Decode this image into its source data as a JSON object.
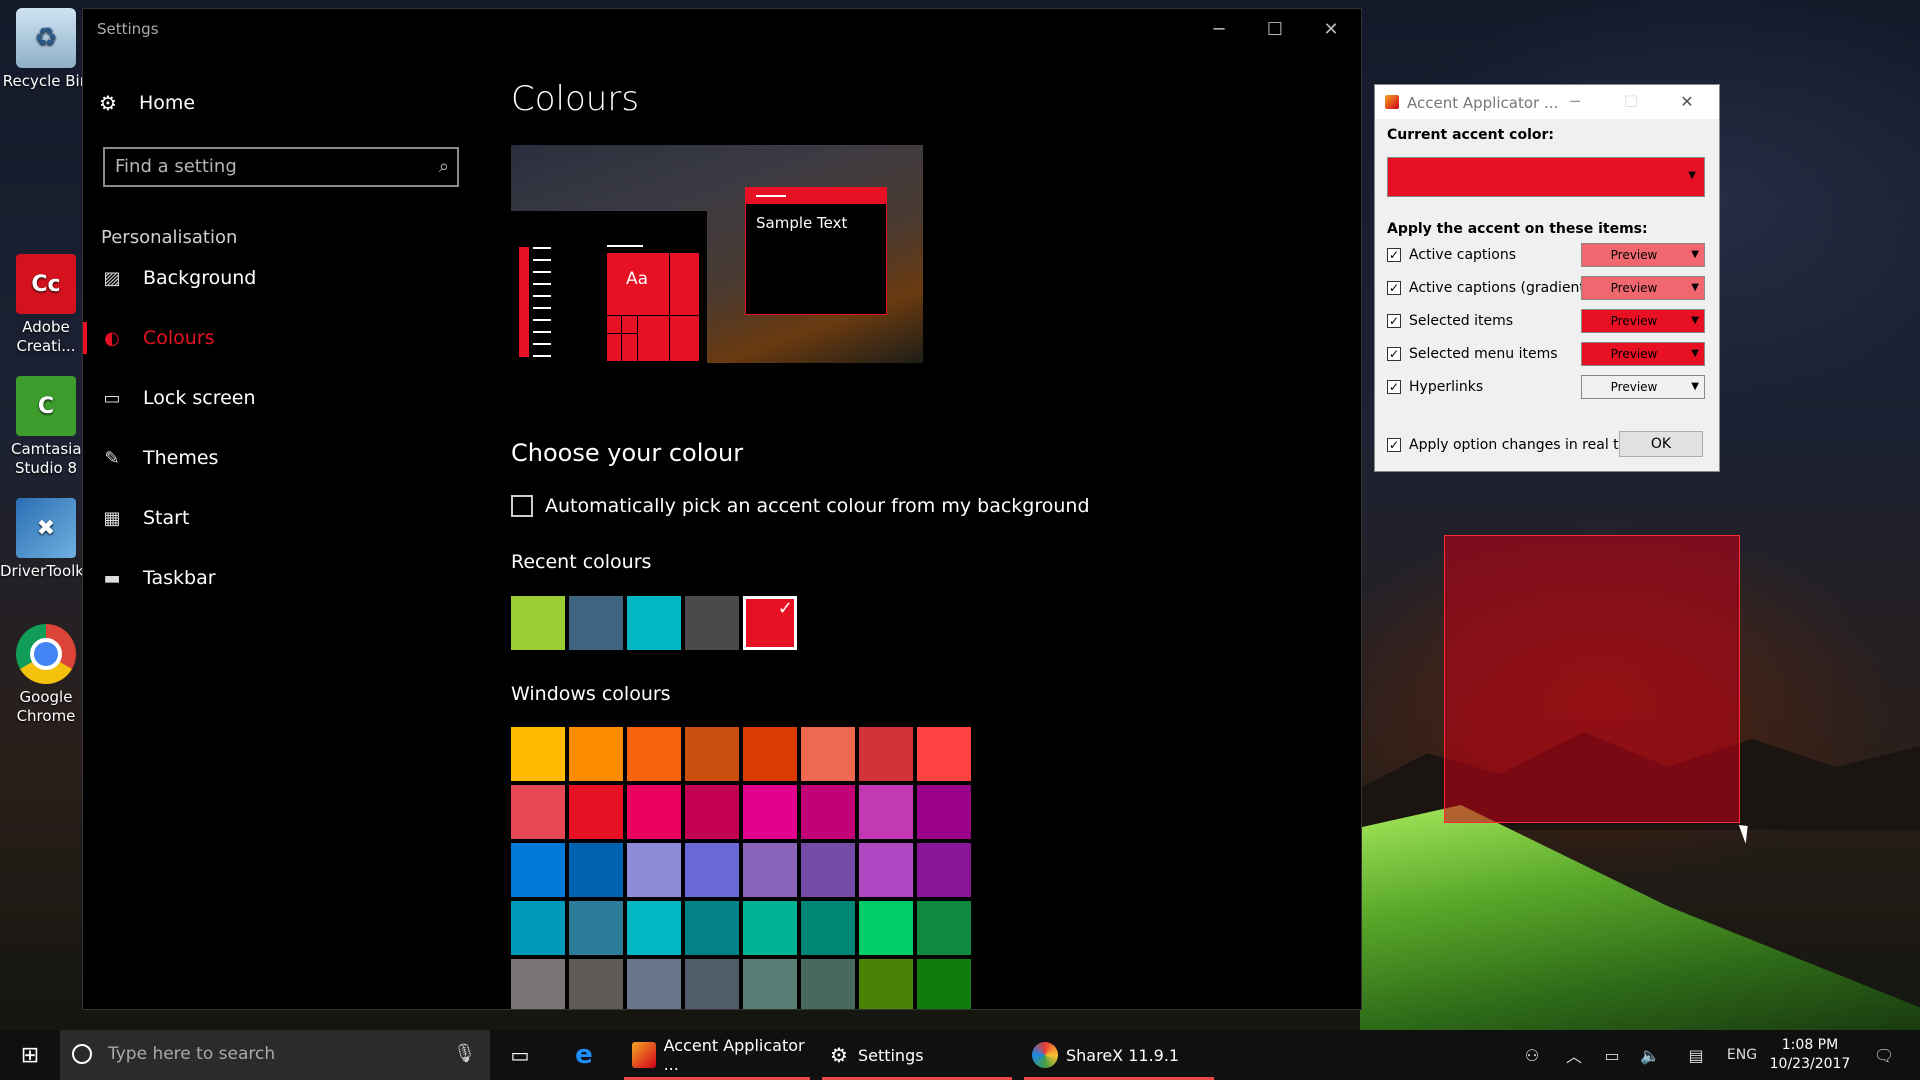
{
  "desktop": {
    "icons": [
      {
        "label": "Recycle Bin"
      },
      {
        "label": "Adobe Creati..."
      },
      {
        "label": "Camtasia Studio 8"
      },
      {
        "label": "DriverToolkit"
      },
      {
        "label": "Google Chrome"
      }
    ]
  },
  "settings": {
    "window_title": "Settings",
    "nav": {
      "home": "Home",
      "search_placeholder": "Find a setting",
      "section": "Personalisation",
      "items": [
        {
          "label": "Background",
          "icon": "image-icon"
        },
        {
          "label": "Colours",
          "icon": "palette-icon",
          "active": true
        },
        {
          "label": "Lock screen",
          "icon": "lock-screen-icon"
        },
        {
          "label": "Themes",
          "icon": "themes-icon"
        },
        {
          "label": "Start",
          "icon": "start-icon"
        },
        {
          "label": "Taskbar",
          "icon": "taskbar-icon"
        }
      ]
    },
    "content": {
      "title": "Colours",
      "preview_aa": "Aa",
      "preview_sample": "Sample Text",
      "choose_heading": "Choose your colour",
      "auto_pick_label": "Automatically pick an accent colour from my background",
      "recent_label": "Recent colours",
      "recent_colours": [
        "#9acd32",
        "#3e6580",
        "#00b7c3",
        "#4c4a48",
        "#e81123"
      ],
      "windows_label": "Windows colours",
      "windows_colours": [
        [
          "#ffb900",
          "#ff8c00",
          "#f7630c",
          "#ca5010",
          "#da3b01",
          "#ef6950",
          "#d13438",
          "#ff4343"
        ],
        [
          "#e74856",
          "#e81123",
          "#ea005e",
          "#c30052",
          "#e3008c",
          "#bf0077",
          "#c239b3",
          "#9a0089"
        ],
        [
          "#0078d7",
          "#0063b1",
          "#8e8cd8",
          "#6b69d6",
          "#8764b8",
          "#744da9",
          "#b146c2",
          "#881798"
        ],
        [
          "#0099bc",
          "#2d7d9a",
          "#00b7c3",
          "#038387",
          "#00b294",
          "#018574",
          "#00cc6a",
          "#10893e"
        ],
        [
          "#7a7574",
          "#5d5a58",
          "#68768a",
          "#515c6b",
          "#567c73",
          "#486860",
          "#498205",
          "#107c10"
        ]
      ]
    }
  },
  "accent_app": {
    "title": "Accent Applicator ...",
    "current_label": "Current accent color:",
    "current_color": "#e81123",
    "apply_label": "Apply the accent on these items:",
    "items": [
      {
        "label": "Active captions",
        "preview": "Preview",
        "preview_bg": "#f0676f"
      },
      {
        "label": "Active captions (gradient)",
        "preview": "Preview",
        "preview_bg": "#f0676f"
      },
      {
        "label": "Selected items",
        "preview": "Preview",
        "preview_bg": "#e81123"
      },
      {
        "label": "Selected menu items",
        "preview": "Preview",
        "preview_bg": "#e81123"
      },
      {
        "label": "Hyperlinks",
        "preview": "Preview",
        "preview_bg": "#f0f0f0"
      }
    ],
    "realtime_label": "Apply option changes in real time",
    "ok_label": "OK"
  },
  "taskbar": {
    "search_placeholder": "Type here to search",
    "apps": [
      {
        "label": "Accent Applicator ..."
      },
      {
        "label": "Settings"
      },
      {
        "label": "ShareX 11.9.1"
      }
    ],
    "language": "ENG",
    "time": "1:08 PM",
    "date": "10/23/2017"
  }
}
